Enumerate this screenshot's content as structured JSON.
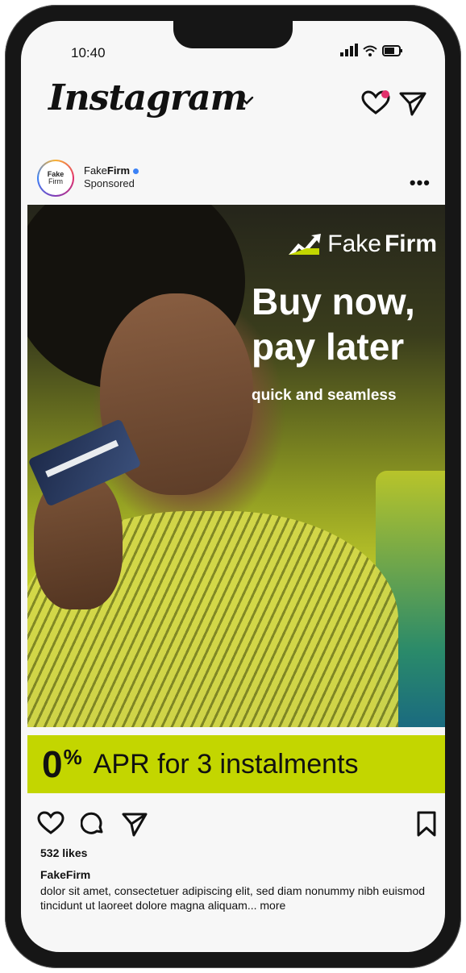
{
  "status_bar": {
    "time": "10:40",
    "icons": [
      "signal-icon",
      "wifi-icon",
      "battery-icon"
    ]
  },
  "header": {
    "logo_text": "Instagram",
    "icons": [
      "chevron-down-icon",
      "heart-icon",
      "send-icon"
    ],
    "notification_dot_color": "#e1306c"
  },
  "post": {
    "avatar_line1": "Fake",
    "avatar_line2": "Firm",
    "account_prefix": "Fake",
    "account_bold": "Firm",
    "sponsored": "Sponsored",
    "more": "•••"
  },
  "ad": {
    "brand_prefix": "Fake",
    "brand_bold": "Firm",
    "headline_line1": "Buy now,",
    "headline_line2": "pay later",
    "subline": "quick and seamless",
    "apr_number": "0",
    "apr_percent": "%",
    "apr_text": "APR for 3 instalments",
    "accent_color": "#c3d600"
  },
  "actions": {
    "icons": [
      "heart-icon",
      "comment-icon",
      "share-icon",
      "bookmark-icon"
    ]
  },
  "likes": "532 likes",
  "caption": {
    "account": "FakeFirm",
    "text": "dolor sit amet, consectetuer adipiscing elit, sed diam nonummy nibh euismod tincidunt ut laoreet dolore magna aliquam...",
    "more": "more"
  }
}
